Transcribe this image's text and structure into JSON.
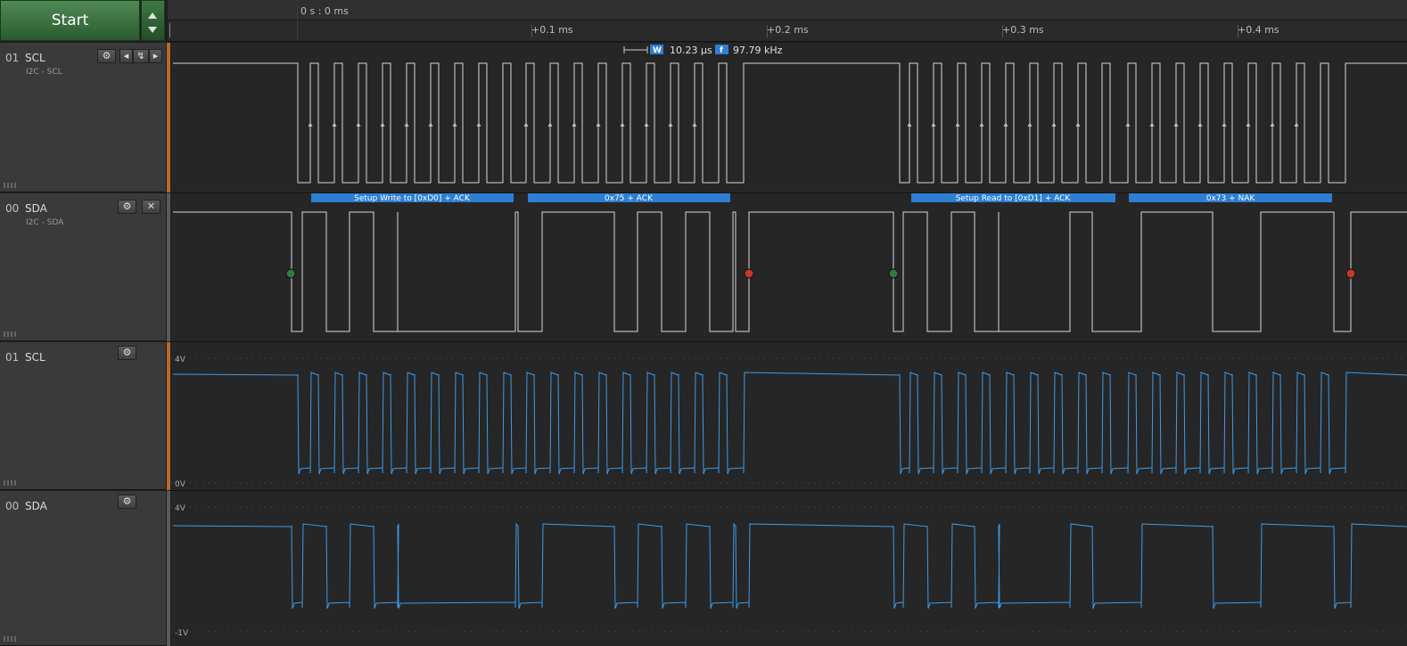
{
  "toolbar": {
    "start_label": "Start"
  },
  "ruler": {
    "origin_label": "0 s : 0 ms",
    "ticks": [
      "+0.1 ms",
      "+0.2 ms",
      "+0.3 ms",
      "+0.4 ms"
    ]
  },
  "measurement": {
    "width_badge": "W",
    "width_value": "10.23 µs",
    "freq_badge": "f",
    "freq_value": "97.79 kHz"
  },
  "channels": [
    {
      "number": "01",
      "name": "SCL",
      "sub": "I2C - SCL"
    },
    {
      "number": "00",
      "name": "SDA",
      "sub": "I2C - SDA"
    },
    {
      "number": "01",
      "name": "SCL",
      "sub": ""
    },
    {
      "number": "00",
      "name": "SDA",
      "sub": ""
    }
  ],
  "decodes": [
    "Setup Write to [0xD0] + ACK",
    "0x75 + ACK",
    "Setup Read to [0xD1] + ACK",
    "0x73 + NAK"
  ],
  "analog_scale": {
    "scl_top": "4V",
    "scl_bottom": "0V",
    "sda_top": "4V",
    "sda_bottom": "-1V"
  },
  "colors": {
    "accent_green": "#3f7744",
    "analog_blue": "#3d9be9",
    "decode_blue": "#2d7fd3",
    "marker_start": "#2e7d3e",
    "marker_stop": "#c0392b",
    "separator_orange": "#b9692a"
  }
}
